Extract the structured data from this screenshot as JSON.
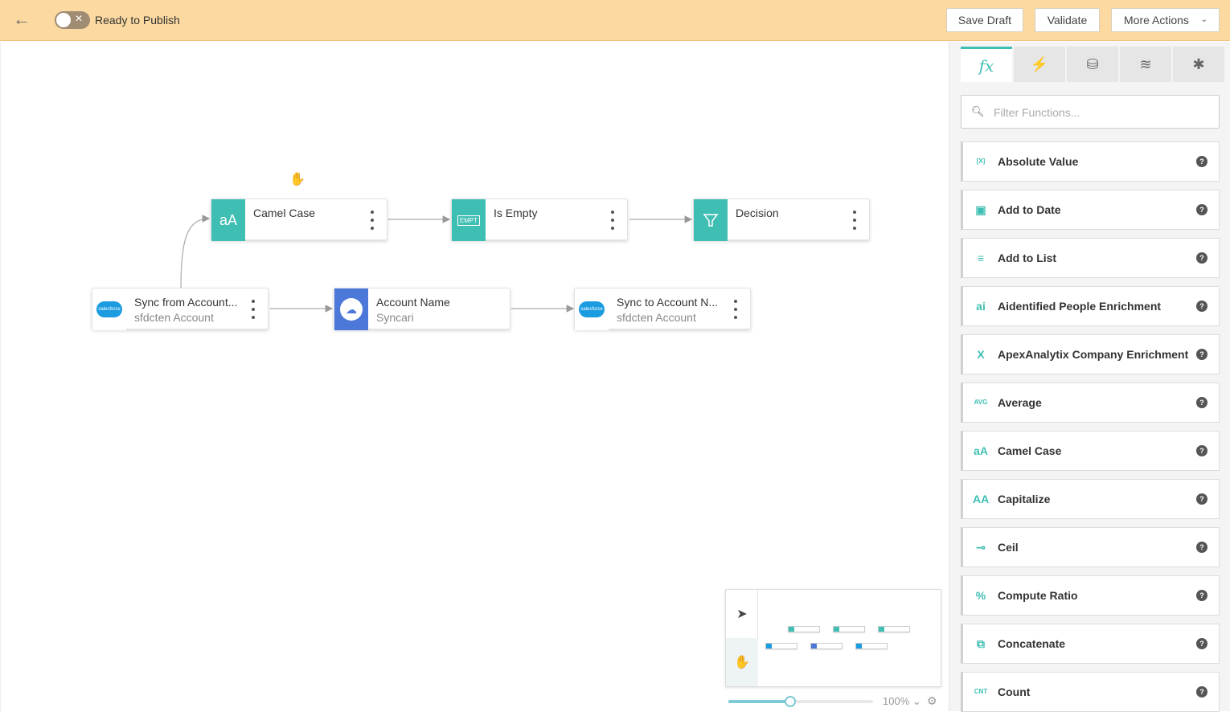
{
  "topbar": {
    "back_icon": "arrow-left-icon",
    "publish_label": "Ready to Publish",
    "toggle_off_mark": "✕",
    "save_draft": "Save Draft",
    "validate": "Validate",
    "more_actions": "More Actions"
  },
  "nodes": {
    "camel_case": {
      "title": "Camel Case",
      "icon_text": "aA"
    },
    "is_empty": {
      "title": "Is Empty",
      "icon_text": "EMPT"
    },
    "decision": {
      "title": "Decision",
      "icon": "funnel-icon"
    },
    "sync_from": {
      "title": "Sync from Account...",
      "subtitle": "sfdcten Account",
      "icon_text": "salesforce"
    },
    "account_name": {
      "title": "Account Name",
      "subtitle": "Syncari",
      "icon": "cloud-sync-icon"
    },
    "sync_to": {
      "title": "Sync to Account N...",
      "subtitle": "sfdcten Account",
      "icon_text": "salesforce"
    }
  },
  "zoom": {
    "label": "100%",
    "level_fraction": 0.43
  },
  "panel": {
    "tabs": [
      {
        "label": "fx",
        "icon": "function-icon"
      },
      {
        "label": "⚡",
        "icon": "lightning-icon"
      },
      {
        "label": "⛁",
        "icon": "database-sync-icon"
      },
      {
        "label": "≋",
        "icon": "database-stack-icon"
      },
      {
        "label": "✱",
        "icon": "puzzle-icon"
      }
    ],
    "filter_placeholder": "Filter Functions...",
    "functions": [
      {
        "name": "Absolute Value",
        "icon": "[X]"
      },
      {
        "name": "Add to Date",
        "icon": "▣"
      },
      {
        "name": "Add to List",
        "icon": "≡"
      },
      {
        "name": "Aidentified People Enrichment",
        "icon": "ai"
      },
      {
        "name": "ApexAnalytix Company Enrichment",
        "icon": "X"
      },
      {
        "name": "Average",
        "icon": "AVG"
      },
      {
        "name": "Camel Case",
        "icon": "aA"
      },
      {
        "name": "Capitalize",
        "icon": "AA"
      },
      {
        "name": "Ceil",
        "icon": "⊸"
      },
      {
        "name": "Compute Ratio",
        "icon": "%"
      },
      {
        "name": "Concatenate",
        "icon": "⧉"
      },
      {
        "name": "Count",
        "icon": "CNT"
      }
    ],
    "help_mark": "?"
  }
}
